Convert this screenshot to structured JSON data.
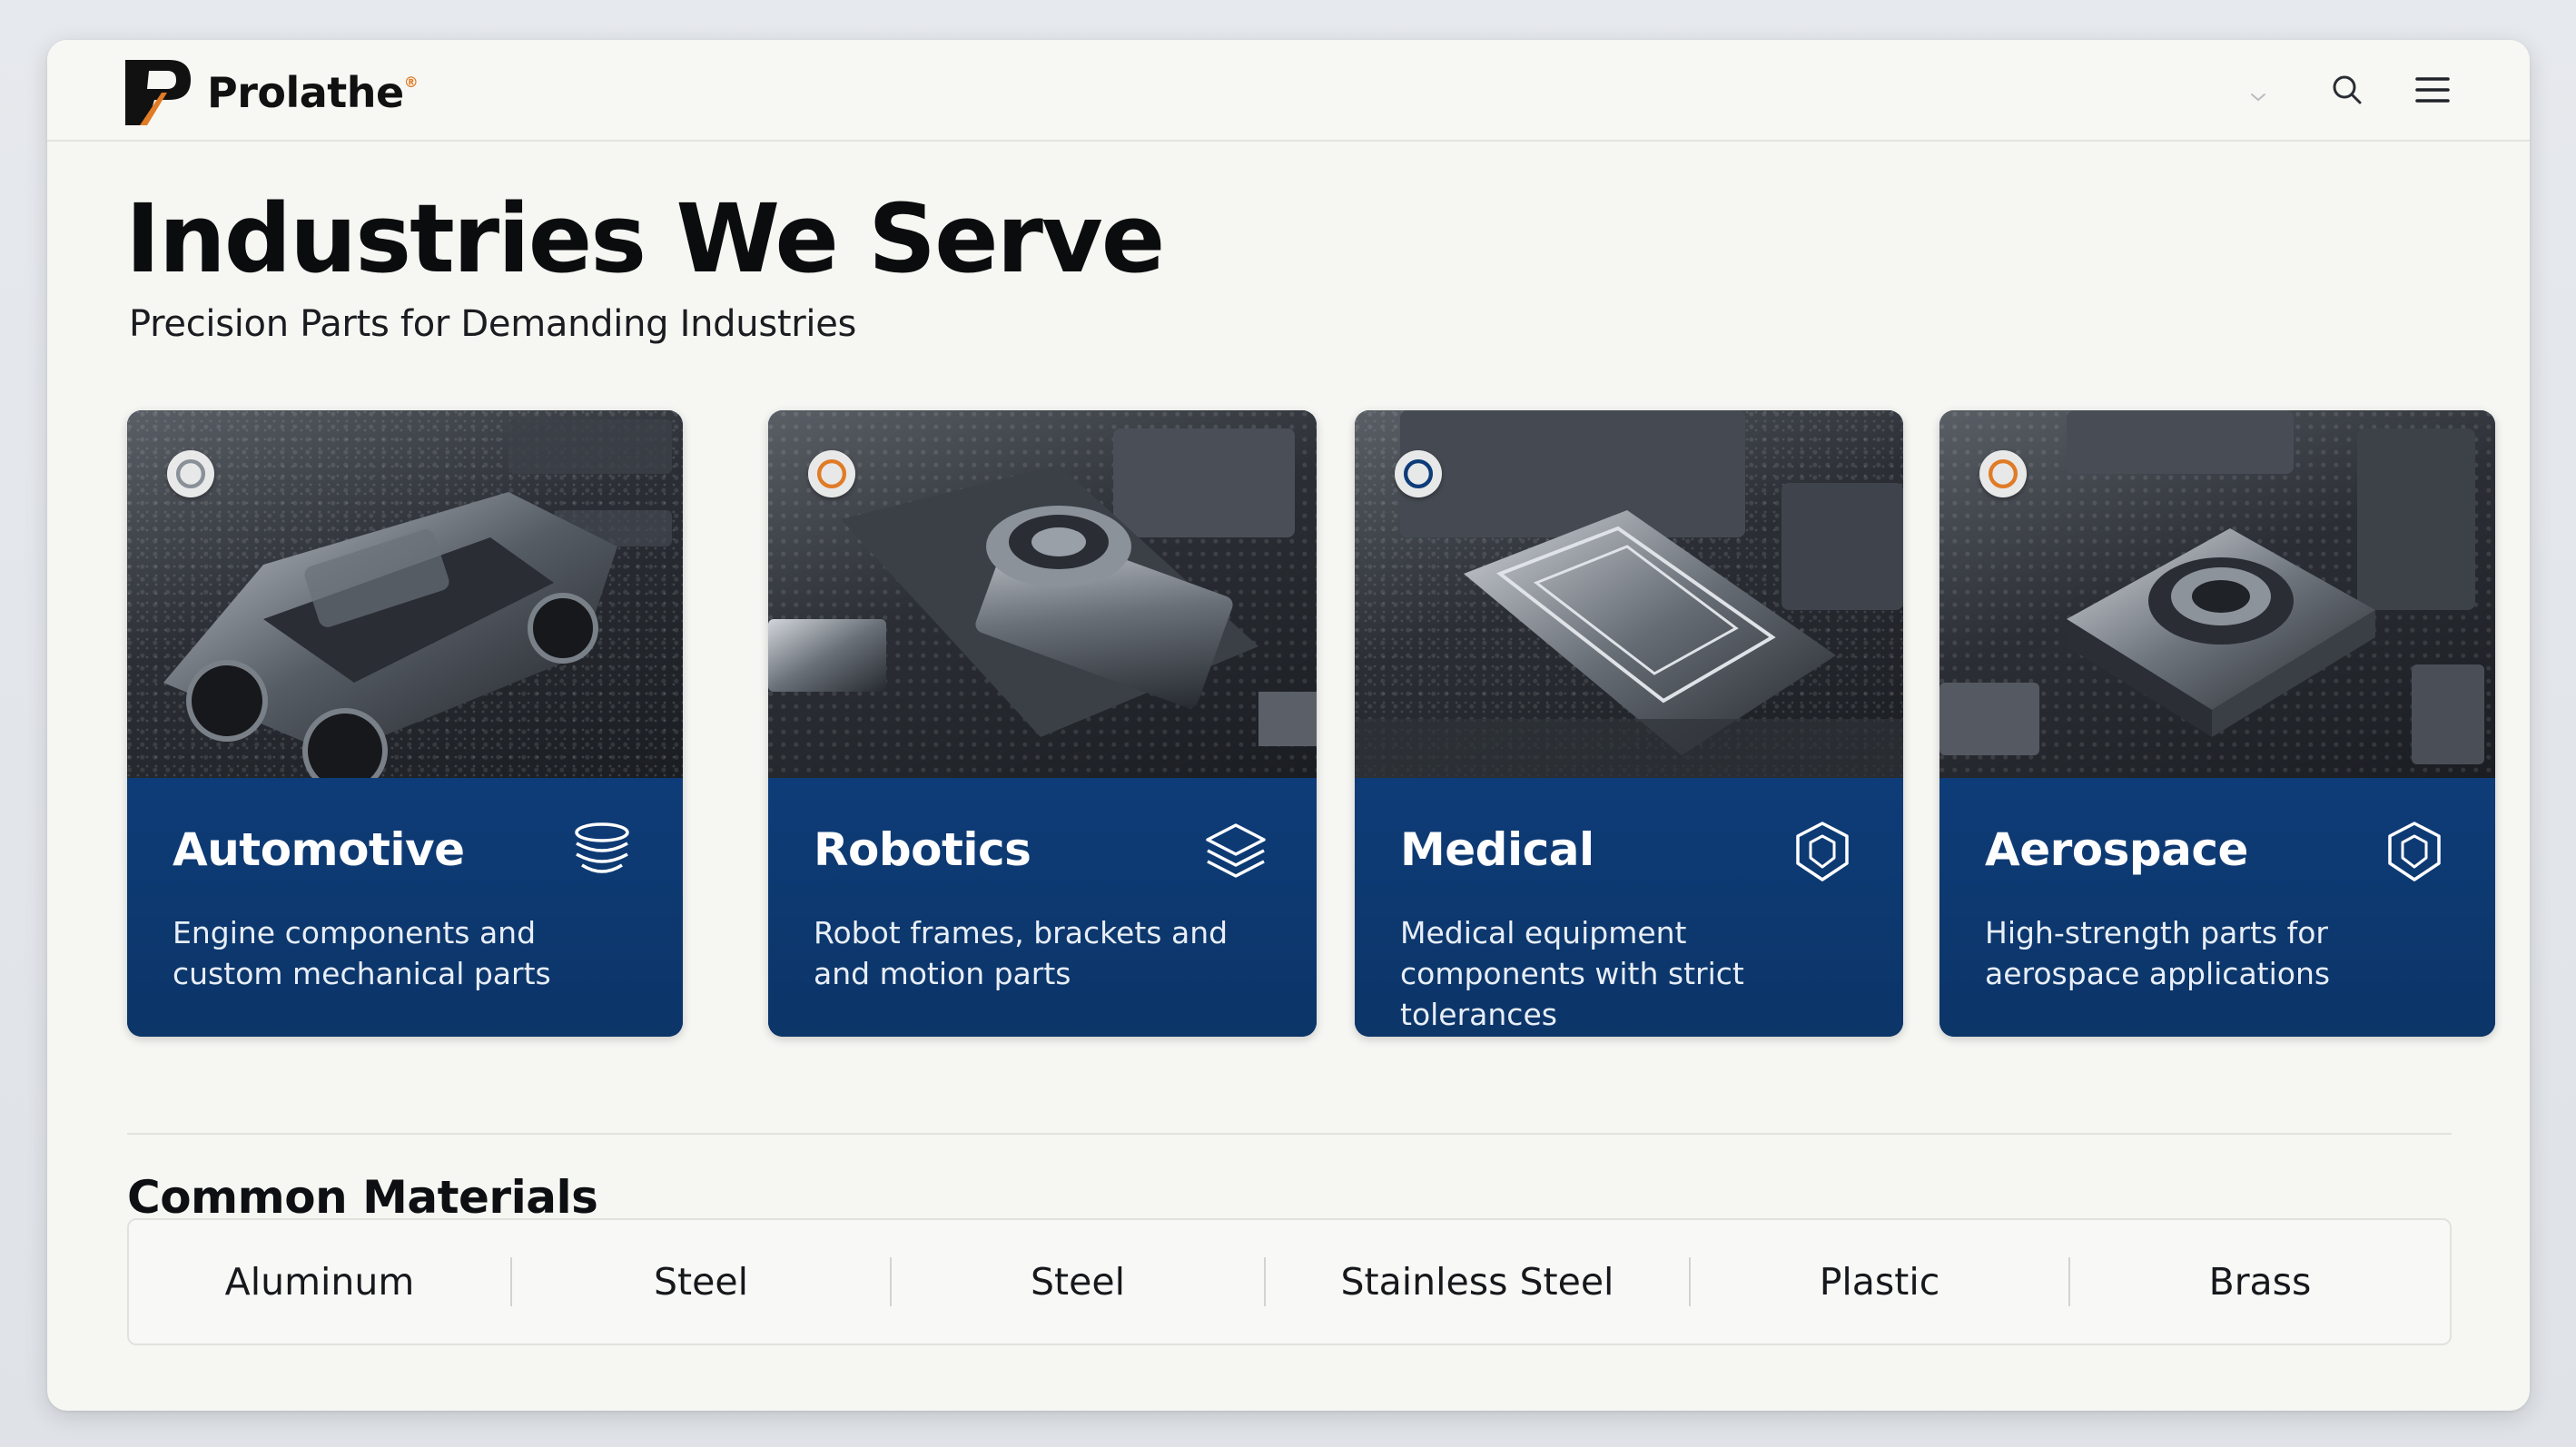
{
  "header": {
    "brand": "Prolathe",
    "brand_mark": "®",
    "icons": [
      "chevron-down-icon",
      "search-icon",
      "menu-icon"
    ]
  },
  "main": {
    "title": "Industries We Serve",
    "subtitle": "Precision Parts for Demanding Industries"
  },
  "industries": [
    {
      "title": "Automotive",
      "description": "Engine components and custom mechanical parts",
      "icon": "stack-icon"
    },
    {
      "title": "Robotics",
      "description": "Robot frames, brackets and and motion parts",
      "icon": "layers-icon"
    },
    {
      "title": "Medical",
      "description": "Medical equipment components with strict tolerances",
      "icon": "shield-icon"
    },
    {
      "title": "Aerospace",
      "description": "High-strength parts for aerospace applications",
      "icon": "shield-icon"
    }
  ],
  "materials": {
    "title": "Common Materials",
    "items": [
      "Aluminum",
      "Steel",
      "Steel",
      "Stainless Steel",
      "Plastic",
      "Brass"
    ]
  },
  "colors": {
    "card_blue": "#0e3c78",
    "accent_orange": "#e07b26",
    "page_bg": "#f6f6f3"
  }
}
